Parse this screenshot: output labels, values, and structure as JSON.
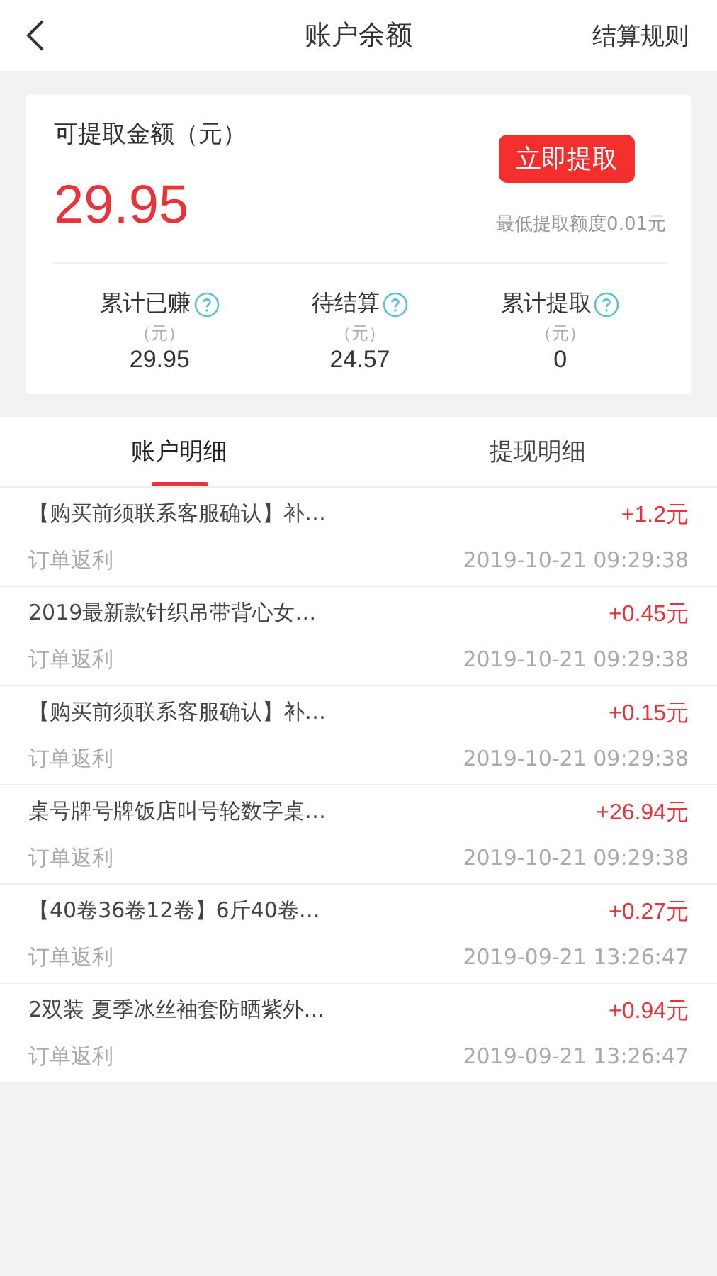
{
  "header": {
    "title": "账户余额",
    "action": "结算规则"
  },
  "balance": {
    "label": "可提取金额（元）",
    "amount": "29.95",
    "button": "立即提取",
    "minimum": "最低提取额度0.01元"
  },
  "stats": [
    {
      "label": "累计已赚",
      "unit": "（元）",
      "value": "29.95"
    },
    {
      "label": "待结算",
      "unit": "（元）",
      "value": "24.57"
    },
    {
      "label": "累计提取",
      "unit": "（元）",
      "value": "0"
    }
  ],
  "tabs": [
    {
      "label": "账户明细",
      "selected": true
    },
    {
      "label": "提现明细",
      "selected": false
    }
  ],
  "records": [
    {
      "title": "【购买前须联系客服确认】补…",
      "type": "订单返利",
      "amount": "+1.2元",
      "time": "2019-10-21 09:29:38"
    },
    {
      "title": "2019最新款针织吊带背心女…",
      "type": "订单返利",
      "amount": "+0.45元",
      "time": "2019-10-21 09:29:38"
    },
    {
      "title": "【购买前须联系客服确认】补…",
      "type": "订单返利",
      "amount": "+0.15元",
      "time": "2019-10-21 09:29:38"
    },
    {
      "title": "桌号牌号牌饭店叫号轮数字桌…",
      "type": "订单返利",
      "amount": "+26.94元",
      "time": "2019-10-21 09:29:38"
    },
    {
      "title": "【40卷36卷12卷】6斤40卷…",
      "type": "订单返利",
      "amount": "+0.27元",
      "time": "2019-09-21 13:26:47"
    },
    {
      "title": "2双装 夏季冰丝袖套防晒紫外…",
      "type": "订单返利",
      "amount": "+0.94元",
      "time": "2019-09-21 13:26:47"
    }
  ]
}
